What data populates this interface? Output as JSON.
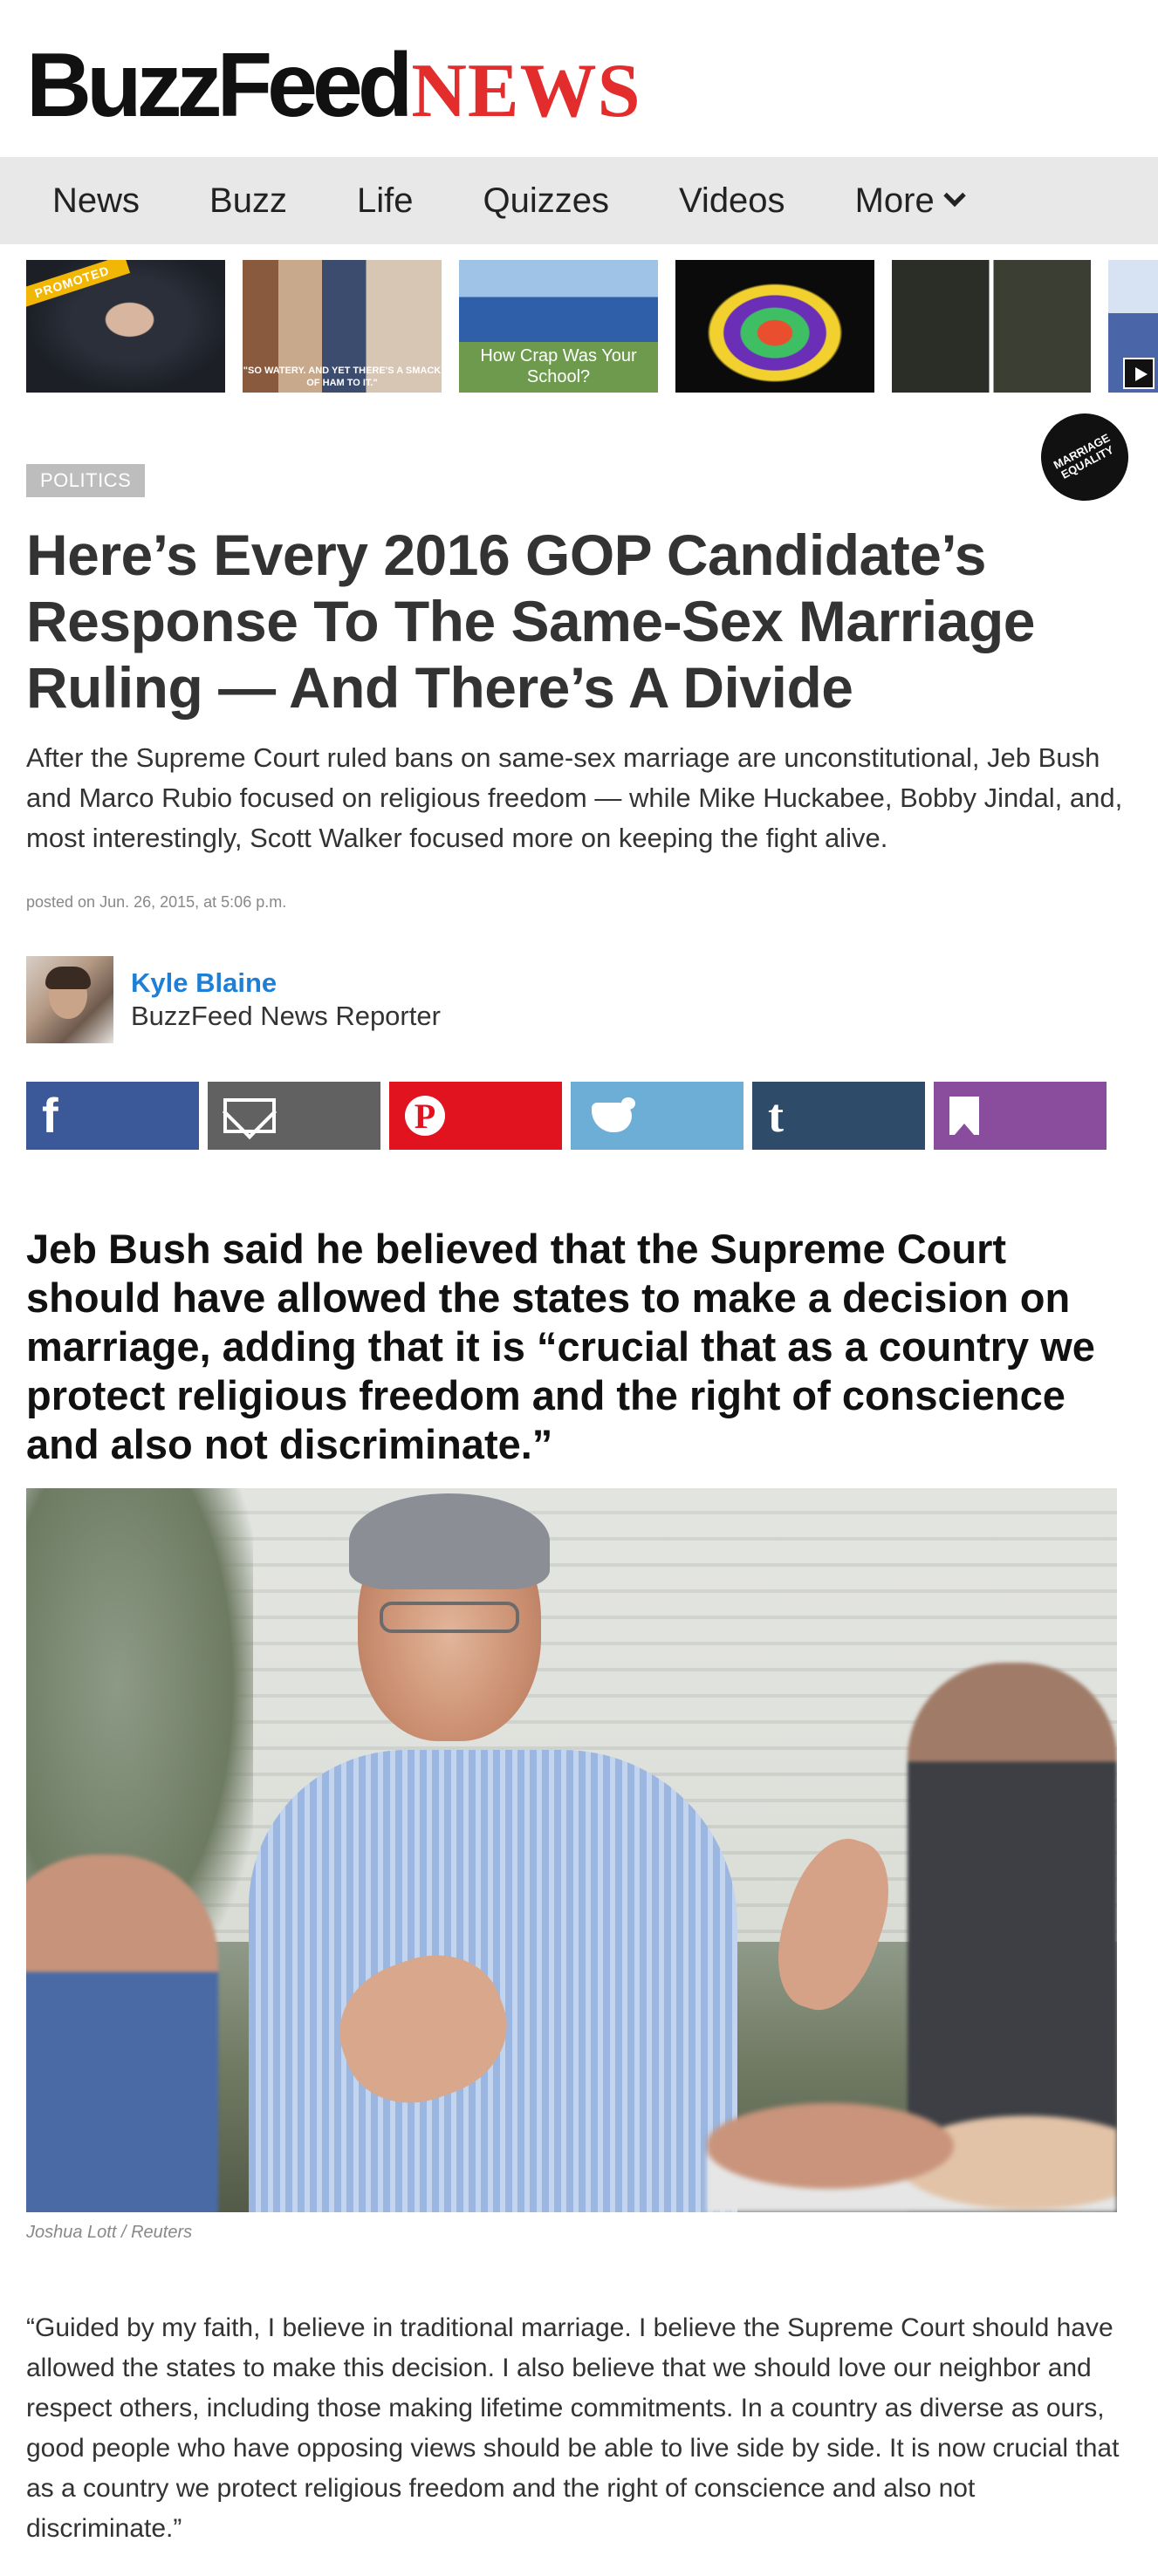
{
  "logo": {
    "buzz": "BuzzFeed",
    "news": "NEWS"
  },
  "nav": {
    "items": [
      "News",
      "Buzz",
      "Life",
      "Quizzes",
      "Videos",
      "More"
    ]
  },
  "promos": {
    "promoted_label": "PROMOTED",
    "caption_2": "\"SO WATERY. AND YET THERE'S A SMACK OF HAM TO IT.\"",
    "caption_3": "How Crap Was Your School?"
  },
  "article": {
    "category": "POLITICS",
    "badge": "MARRIAGE EQUALITY",
    "headline": "Here’s Every 2016 GOP Candidate’s Response To The Same-Sex Marriage Ruling — And There’s A Divide",
    "dek": "After the Supreme Court ruled bans on same-sex marriage are unconstitutional, Jeb Bush and Marco Rubio focused on religious freedom — while Mike Huckabee, Bobby Jindal, and, most interestingly, Scott Walker focused more on keeping the fight alive.",
    "timestamp": "posted on Jun. 26, 2015, at 5:06 p.m.",
    "author": {
      "name": "Kyle Blaine",
      "role": "BuzzFeed News Reporter"
    },
    "share": {
      "facebook_icon": "f",
      "pinterest_icon": "P",
      "tumblr_icon": "t"
    },
    "section_heading": "Jeb Bush said he believed that the Supreme Court should have allowed the states to make a decision on marriage, adding that it is “crucial that as a country we protect religious freedom and the right of conscience and also not discriminate.”",
    "photo_credit": "Joshua Lott / Reuters",
    "quote": "“Guided by my faith, I believe in traditional marriage. I believe the Supreme Court should have allowed the states to make this decision. I also believe that we should love our neighbor and respect others, including those making lifetime commitments. In a country as diverse as ours, good people who have opposing views should be able to live side by side. It is now crucial that as a country we protect religious freedom and the right of conscience and also not discriminate.”"
  },
  "colors": {
    "brand_red": "#e32c2c",
    "author_link": "#1e7fd6",
    "facebook": "#3b5998",
    "email": "#616161",
    "pinterest": "#e0131f",
    "twitter": "#6caed6",
    "tumblr": "#2f4b6a",
    "bookmark": "#8a4d9e"
  }
}
